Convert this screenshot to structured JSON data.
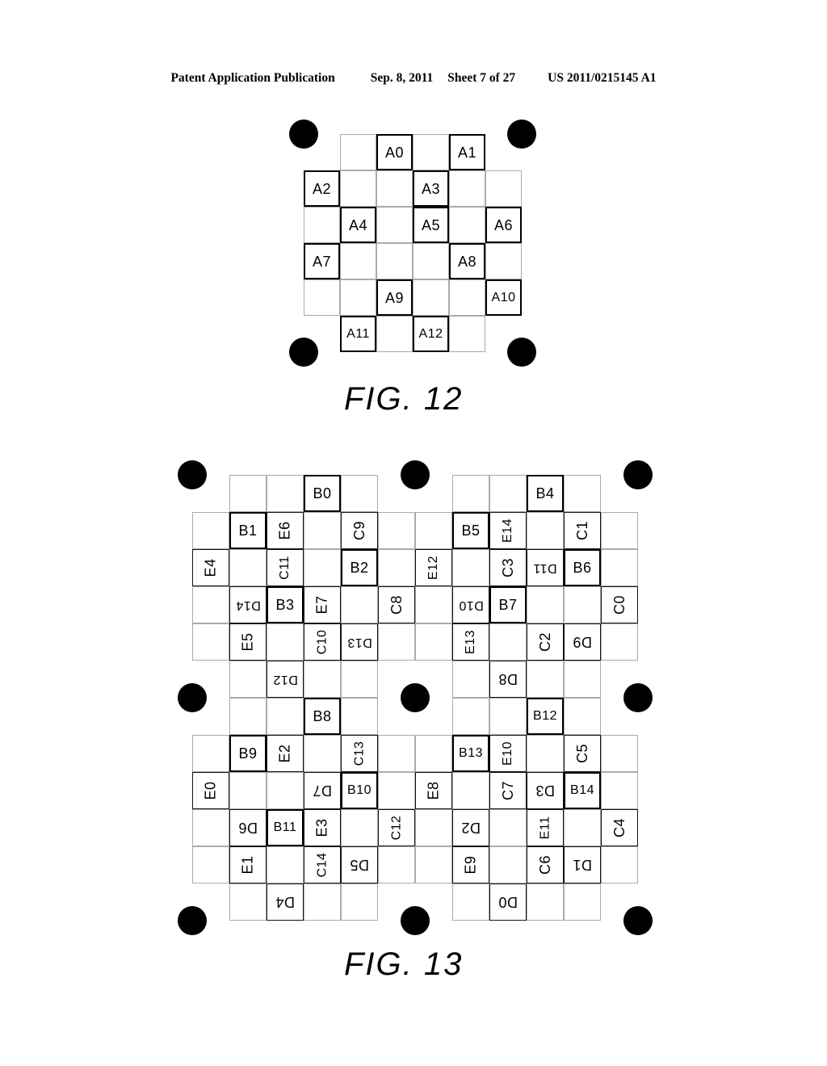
{
  "header": {
    "publication": "Patent Application Publication",
    "date": "Sep. 8, 2011",
    "sheet": "Sheet 7 of 27",
    "number": "US 2011/0215145 A1"
  },
  "figures": [
    {
      "caption": "FIG. 12",
      "grid": {
        "cols": 6,
        "rows": 6,
        "cell": 45
      },
      "cells": [
        {
          "label": "A0",
          "col": 3,
          "row": 1,
          "rot": 0,
          "bold": true
        },
        {
          "label": "A1",
          "col": 5,
          "row": 1,
          "rot": 0,
          "bold": true
        },
        {
          "label": "A2",
          "col": 1,
          "row": 2,
          "rot": 0,
          "bold": true
        },
        {
          "label": "A3",
          "col": 4,
          "row": 2,
          "rot": 0,
          "bold": true
        },
        {
          "label": "A4",
          "col": 2,
          "row": 3,
          "rot": 0,
          "bold": true
        },
        {
          "label": "A5",
          "col": 4,
          "row": 3,
          "rot": 0,
          "bold": true
        },
        {
          "label": "A6",
          "col": 6,
          "row": 3,
          "rot": 0,
          "bold": true
        },
        {
          "label": "A7",
          "col": 1,
          "row": 4,
          "rot": 0,
          "bold": true
        },
        {
          "label": "A8",
          "col": 5,
          "row": 4,
          "rot": 0,
          "bold": true
        },
        {
          "label": "A9",
          "col": 3,
          "row": 5,
          "rot": 0,
          "bold": true
        },
        {
          "label": "A10",
          "col": 6,
          "row": 5,
          "rot": 0,
          "bold": true
        },
        {
          "label": "A11",
          "col": 2,
          "row": 6,
          "rot": 0,
          "bold": true
        },
        {
          "label": "A12",
          "col": 4,
          "row": 6,
          "rot": 0,
          "bold": true
        }
      ],
      "dots": [
        {
          "cx": 0,
          "cy": 0
        },
        {
          "cx": 1,
          "cy": 0
        },
        {
          "cx": 0,
          "cy": 1
        },
        {
          "cx": 1,
          "cy": 1
        }
      ]
    },
    {
      "caption": "FIG. 13",
      "grid": {
        "cols": 12,
        "rows": 12,
        "cell": 46
      },
      "cells": [
        {
          "label": "B0",
          "col": 4,
          "row": 1,
          "rot": 0,
          "bold": true
        },
        {
          "label": "B1",
          "col": 2,
          "row": 2,
          "rot": 0,
          "bold": true
        },
        {
          "label": "E6",
          "col": 3,
          "row": 2,
          "rot": 90,
          "bold": false
        },
        {
          "label": "C9",
          "col": 5,
          "row": 2,
          "rot": 90,
          "bold": false
        },
        {
          "label": "E4",
          "col": 1,
          "row": 3,
          "rot": 90,
          "bold": false
        },
        {
          "label": "C11",
          "col": 3,
          "row": 3,
          "rot": 90,
          "bold": false
        },
        {
          "label": "B2",
          "col": 5,
          "row": 3,
          "rot": 0,
          "bold": true
        },
        {
          "label": "D14",
          "col": 2,
          "row": 4,
          "rot": 180,
          "bold": false
        },
        {
          "label": "B3",
          "col": 3,
          "row": 4,
          "rot": 0,
          "bold": true
        },
        {
          "label": "E7",
          "col": 4,
          "row": 4,
          "rot": 90,
          "bold": false
        },
        {
          "label": "C8",
          "col": 6,
          "row": 4,
          "rot": 90,
          "bold": false
        },
        {
          "label": "E5",
          "col": 2,
          "row": 5,
          "rot": 90,
          "bold": false
        },
        {
          "label": "C10",
          "col": 4,
          "row": 5,
          "rot": 90,
          "bold": false
        },
        {
          "label": "D13",
          "col": 5,
          "row": 5,
          "rot": 180,
          "bold": false
        },
        {
          "label": "D12",
          "col": 3,
          "row": 6,
          "rot": 180,
          "bold": false
        },
        {
          "label": "B4",
          "col": 10,
          "row": 1,
          "rot": 0,
          "bold": true
        },
        {
          "label": "B5",
          "col": 8,
          "row": 2,
          "rot": 0,
          "bold": true
        },
        {
          "label": "E14",
          "col": 9,
          "row": 2,
          "rot": 90,
          "bold": false
        },
        {
          "label": "C1",
          "col": 11,
          "row": 2,
          "rot": 90,
          "bold": false
        },
        {
          "label": "E12",
          "col": 7,
          "row": 3,
          "rot": 90,
          "bold": false
        },
        {
          "label": "C3",
          "col": 9,
          "row": 3,
          "rot": 90,
          "bold": false
        },
        {
          "label": "D11",
          "col": 10,
          "row": 3,
          "rot": 180,
          "bold": false
        },
        {
          "label": "B6",
          "col": 11,
          "row": 3,
          "rot": 0,
          "bold": true
        },
        {
          "label": "D10",
          "col": 8,
          "row": 4,
          "rot": 180,
          "bold": false
        },
        {
          "label": "B7",
          "col": 9,
          "row": 4,
          "rot": 0,
          "bold": true
        },
        {
          "label": "C0",
          "col": 12,
          "row": 4,
          "rot": 90,
          "bold": false
        },
        {
          "label": "E13",
          "col": 8,
          "row": 5,
          "rot": 90,
          "bold": false
        },
        {
          "label": "C2",
          "col": 10,
          "row": 5,
          "rot": 90,
          "bold": false
        },
        {
          "label": "D9",
          "col": 11,
          "row": 5,
          "rot": 180,
          "bold": false
        },
        {
          "label": "D8",
          "col": 9,
          "row": 6,
          "rot": 180,
          "bold": false
        },
        {
          "label": "B8",
          "col": 4,
          "row": 7,
          "rot": 0,
          "bold": true
        },
        {
          "label": "B9",
          "col": 2,
          "row": 8,
          "rot": 0,
          "bold": true
        },
        {
          "label": "E2",
          "col": 3,
          "row": 8,
          "rot": 90,
          "bold": false
        },
        {
          "label": "C13",
          "col": 5,
          "row": 8,
          "rot": 90,
          "bold": false
        },
        {
          "label": "E0",
          "col": 1,
          "row": 9,
          "rot": 90,
          "bold": false
        },
        {
          "label": "D7",
          "col": 4,
          "row": 9,
          "rot": 180,
          "bold": false
        },
        {
          "label": "B10",
          "col": 5,
          "row": 9,
          "rot": 0,
          "bold": true
        },
        {
          "label": "D6",
          "col": 2,
          "row": 10,
          "rot": 180,
          "bold": false
        },
        {
          "label": "B11",
          "col": 3,
          "row": 10,
          "rot": 0,
          "bold": true
        },
        {
          "label": "E3",
          "col": 4,
          "row": 10,
          "rot": 90,
          "bold": false
        },
        {
          "label": "C12",
          "col": 6,
          "row": 10,
          "rot": 90,
          "bold": false
        },
        {
          "label": "E1",
          "col": 2,
          "row": 11,
          "rot": 90,
          "bold": false
        },
        {
          "label": "C14",
          "col": 4,
          "row": 11,
          "rot": 90,
          "bold": false
        },
        {
          "label": "D5",
          "col": 5,
          "row": 11,
          "rot": 180,
          "bold": false
        },
        {
          "label": "D4",
          "col": 3,
          "row": 12,
          "rot": 180,
          "bold": false
        },
        {
          "label": "B12",
          "col": 10,
          "row": 7,
          "rot": 0,
          "bold": true
        },
        {
          "label": "B13",
          "col": 8,
          "row": 8,
          "rot": 0,
          "bold": true
        },
        {
          "label": "E10",
          "col": 9,
          "row": 8,
          "rot": 90,
          "bold": false
        },
        {
          "label": "C5",
          "col": 11,
          "row": 8,
          "rot": 90,
          "bold": false
        },
        {
          "label": "E8",
          "col": 7,
          "row": 9,
          "rot": 90,
          "bold": false
        },
        {
          "label": "C7",
          "col": 9,
          "row": 9,
          "rot": 90,
          "bold": false
        },
        {
          "label": "D3",
          "col": 10,
          "row": 9,
          "rot": 180,
          "bold": false
        },
        {
          "label": "B14",
          "col": 11,
          "row": 9,
          "rot": 0,
          "bold": true
        },
        {
          "label": "D2",
          "col": 8,
          "row": 10,
          "rot": 180,
          "bold": false
        },
        {
          "label": "E11",
          "col": 10,
          "row": 10,
          "rot": 90,
          "bold": false
        },
        {
          "label": "C4",
          "col": 12,
          "row": 10,
          "rot": 90,
          "bold": false
        },
        {
          "label": "E9",
          "col": 8,
          "row": 11,
          "rot": 90,
          "bold": false
        },
        {
          "label": "C6",
          "col": 10,
          "row": 11,
          "rot": 90,
          "bold": false
        },
        {
          "label": "D1",
          "col": 11,
          "row": 11,
          "rot": 180,
          "bold": false
        },
        {
          "label": "D0",
          "col": 9,
          "row": 12,
          "rot": 180,
          "bold": false
        }
      ]
    }
  ],
  "colors": {
    "ink": "#000000",
    "grid_light": "#aaaaaa",
    "paper": "#ffffff"
  }
}
